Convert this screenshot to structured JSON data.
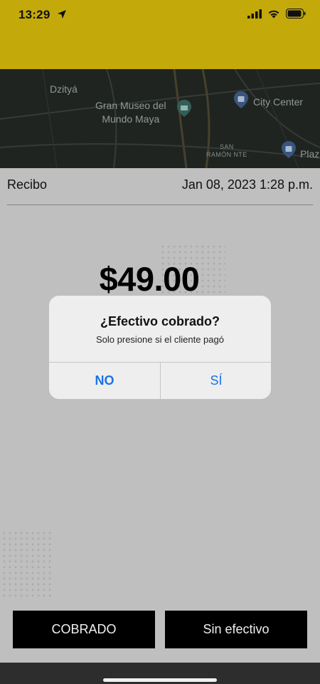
{
  "status_bar": {
    "time": "13:29"
  },
  "map": {
    "labels": {
      "dzitya": "Dzityá",
      "museo": "Gran Museo del\nMundo Maya",
      "city_center": "City Center",
      "san_ramon": "SAN\nRAMÓN NTE",
      "plaza": "Plaz"
    }
  },
  "receipt": {
    "label": "Recibo",
    "date": "Jan 08, 2023 1:28 p.m.",
    "amount": "$49.00"
  },
  "alert": {
    "title": "¿Efectivo cobrado?",
    "message": "Solo presione si el cliente pagó",
    "no_label": "NO",
    "yes_label": "SÍ",
    "button_color": "#1a73e8"
  },
  "actions": {
    "cobrado_label": "COBRADO",
    "sin_efectivo_label": "Sin efectivo"
  },
  "colors": {
    "header": "#d1b40c",
    "background": "#cbcbcb",
    "button": "#000000"
  }
}
